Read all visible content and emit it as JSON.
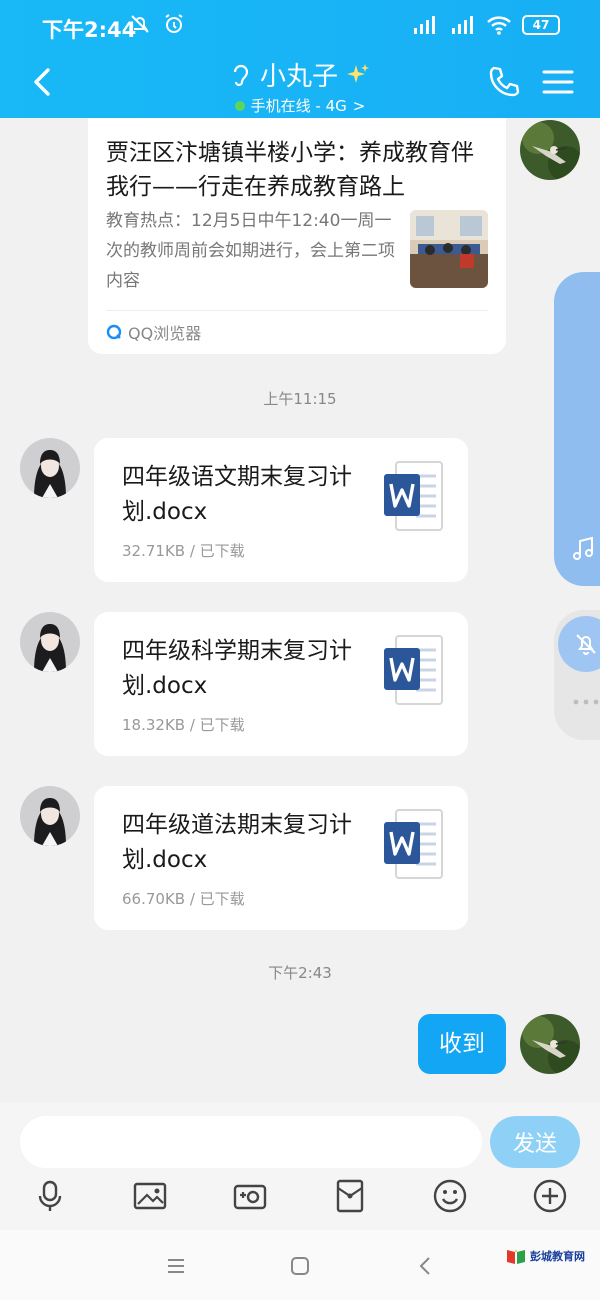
{
  "status_bar": {
    "time": "下午2:44",
    "battery": "47"
  },
  "header": {
    "title": "小丸子",
    "subtitle": "手机在线 - 4G",
    "subtitle_arrow": ">"
  },
  "messages": {
    "news": {
      "title": "贾汪区汴塘镇半楼小学：养成教育伴我行——行走在养成教育路上",
      "desc": "教育热点：12月5日中午12:40一周一次的教师周前会如期进行，会上第二项内容",
      "source": "QQ浏览器"
    },
    "time1": "上午11:15",
    "files": [
      {
        "name": "四年级语文期末复习计划.docx",
        "meta": "32.71KB / 已下载"
      },
      {
        "name": "四年级科学期末复习计划.docx",
        "meta": "18.32KB / 已下载"
      },
      {
        "name": "四年级道法期末复习计划.docx",
        "meta": "66.70KB / 已下载"
      }
    ],
    "time2": "下午2:43",
    "reply": "收到"
  },
  "input": {
    "placeholder": "",
    "send_label": "发送"
  },
  "watermark": "彭城教育网",
  "colors": {
    "header": "#18b9f6",
    "bubble": "#12a6f4",
    "word": "#2b579a"
  }
}
